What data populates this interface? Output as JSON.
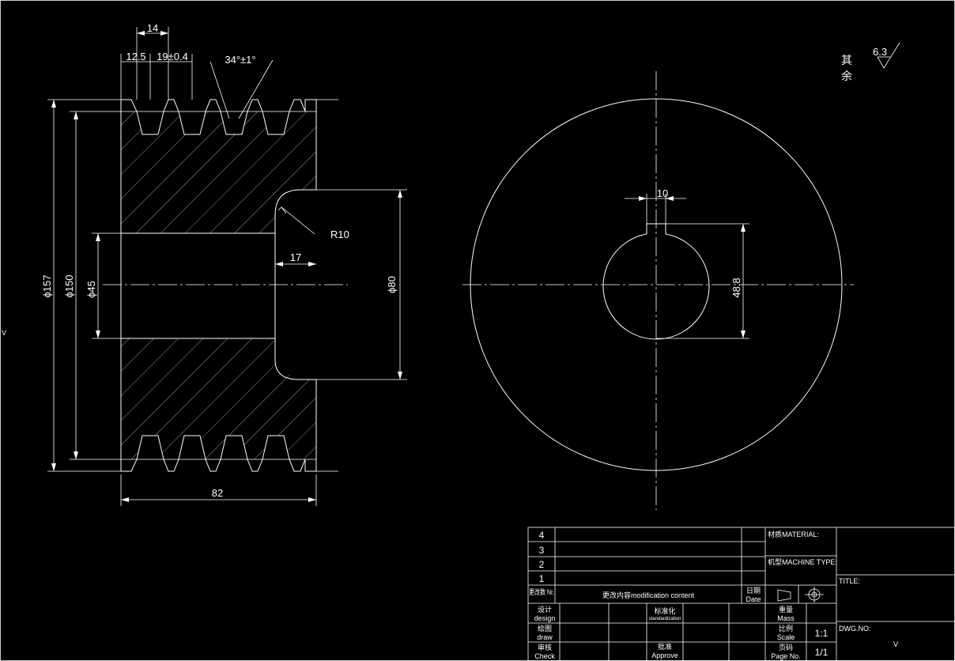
{
  "dimensions": {
    "d157": "ϕ157",
    "d150": "ϕ150",
    "d45": "ϕ45",
    "d80": "ϕ80",
    "width82": "82",
    "pitch14": "14",
    "w12_5": "12.5",
    "w19": "19±0.4",
    "angle": "34°±1°",
    "r10": "R10",
    "depth17": "17",
    "key10": "10",
    "key48_8": "48.8"
  },
  "roughness": {
    "label_line1": "其",
    "label_line2": "余",
    "value": "6.3"
  },
  "title_block": {
    "revision_rows": [
      "4",
      "3",
      "2",
      "1"
    ],
    "col_rev_no": "更改数 Nr.",
    "col_content": "更改内容modification content",
    "col_date_cn": "日期",
    "col_date_en": "Date",
    "design_cn": "设计",
    "design_en": "design",
    "draw_cn": "绘图",
    "draw_en": "draw",
    "check_cn": "审核",
    "check_en": "Check",
    "standardize_cn": "标准化",
    "standardize_en": "standardization",
    "approve_cn": "批准",
    "approve_en": "Approve",
    "mass_cn": "重量",
    "mass_en": "Mass",
    "scale_cn": "比例",
    "scale_en": "Scale",
    "scale_value": "1:1",
    "page_cn": "页码",
    "page_en": "Page No.",
    "page_value": "1/1",
    "material_label": "材质MATERIAL:",
    "machine_label": "机型MACHINE TYPE:",
    "title_label": "TITLE:",
    "dwg_label": "DWG.NO:",
    "dwg_value": "V"
  },
  "edge_marks": {
    "left": "V"
  }
}
